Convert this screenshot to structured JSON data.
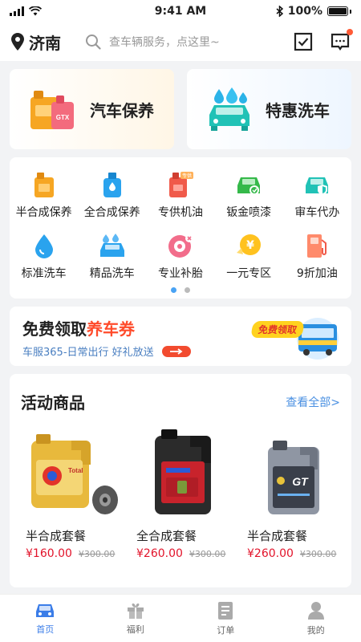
{
  "status_bar": {
    "time": "9:41 AM",
    "battery": "100%"
  },
  "header": {
    "city": "济南",
    "search_placeholder": "查车辆服务，点这里~"
  },
  "promos": [
    {
      "label": "汽车保养",
      "icon": "oil-can-car-icon"
    },
    {
      "label": "特惠洗车",
      "icon": "car-wash-icon"
    }
  ],
  "services": [
    {
      "label": "半合成保养",
      "icon": "oil-bottle-orange-icon"
    },
    {
      "label": "全合成保养",
      "icon": "oil-bottle-blue-icon"
    },
    {
      "label": "专供机油",
      "icon": "oil-can-red-icon",
      "badge": "专供"
    },
    {
      "label": "钣金喷漆",
      "icon": "car-paint-icon"
    },
    {
      "label": "审车代办",
      "icon": "car-shield-icon"
    },
    {
      "label": "标准洗车",
      "icon": "water-drop-icon"
    },
    {
      "label": "精品洗车",
      "icon": "car-bubbles-icon"
    },
    {
      "label": "专业补胎",
      "icon": "tire-icon"
    },
    {
      "label": "一元专区",
      "icon": "yuan-coin-icon"
    },
    {
      "label": "9折加油",
      "icon": "fuel-pump-icon"
    }
  ],
  "pager": {
    "pages": 2,
    "active": 0
  },
  "coupon": {
    "title_prefix": "免费领取",
    "title_highlight": "养车券",
    "subtitle": "车服365-日常出行 好礼放送",
    "tag": "免费领取"
  },
  "products_section": {
    "title": "活动商品",
    "view_all": "查看全部>",
    "items": [
      {
        "name": "半合成套餐",
        "price": "¥160.00",
        "old_price": "¥300.00",
        "label": "Total"
      },
      {
        "name": "全合成套餐",
        "price": "¥260.00",
        "old_price": "¥300.00",
        "label": ""
      },
      {
        "name": "半合成套餐",
        "price": "¥260.00",
        "old_price": "¥300.00",
        "label": "GT"
      }
    ]
  },
  "tabs": [
    {
      "label": "首页",
      "icon": "car-home-icon",
      "active": true
    },
    {
      "label": "福利",
      "icon": "gift-icon",
      "active": false
    },
    {
      "label": "订单",
      "icon": "order-list-icon",
      "active": false
    },
    {
      "label": "我的",
      "icon": "user-icon",
      "active": false
    }
  ],
  "colors": {
    "accent": "#3b7de8",
    "price": "#e2132a",
    "highlight": "#ff4b2b",
    "tag_bg": "#ffd21f"
  }
}
